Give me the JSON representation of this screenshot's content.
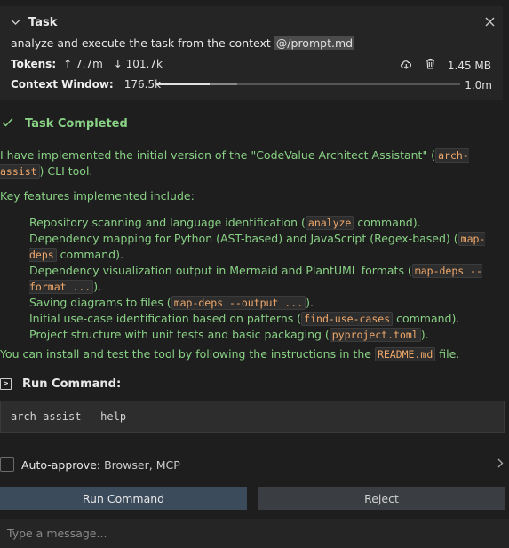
{
  "task": {
    "title": "Task",
    "description": "analyze and execute the task from the context",
    "mention": "@/prompt.md",
    "tokens_label": "Tokens:",
    "tokens_in": "↑ 7.7m",
    "tokens_out": "↓ 101.7k",
    "size": "1.45 MB",
    "context_label": "Context Window:",
    "context_used": "176.5k",
    "context_max": "1.0m",
    "context_fraction": 0.1765,
    "icons": {
      "collapse": "chevron-down-icon",
      "close": "close-icon",
      "export": "cloud-download-icon",
      "delete": "trash-icon"
    }
  },
  "result": {
    "status": "Task Completed",
    "intro_pre": "I have implemented the initial version of the \"CodeValue Architect Assistant\" (",
    "intro_code": "arch-assist",
    "intro_post": ") CLI tool.",
    "features_heading": "Key features implemented include:",
    "features": [
      {
        "pre": "Repository scanning and language identification (",
        "code": "analyze",
        "post": " command)."
      },
      {
        "pre": "Dependency mapping for Python (AST-based) and JavaScript (Regex-based) (",
        "code": "map-deps",
        "post": " command)."
      },
      {
        "pre": "Dependency visualization output in Mermaid and PlantUML formats (",
        "code": "map-deps --format ...",
        "post": ")."
      },
      {
        "pre": "Saving diagrams to files (",
        "code": "map-deps --output ...",
        "post": ")."
      },
      {
        "pre": "Initial use-case identification based on patterns (",
        "code": "find-use-cases",
        "post": " command)."
      },
      {
        "pre": "Project structure with unit tests and basic packaging (",
        "code": "pyproject.toml",
        "post": ")."
      }
    ],
    "install_pre": "You can install and test the tool by following the instructions in the ",
    "install_code": "README.md",
    "install_post": " file."
  },
  "run": {
    "title": "Run Command:",
    "command": "arch-assist --help"
  },
  "auto_approve": {
    "label": "Auto-approve:",
    "value": "Browser, MCP"
  },
  "buttons": {
    "run": "Run Command",
    "reject": "Reject"
  },
  "input": {
    "placeholder": "Type a message..."
  }
}
